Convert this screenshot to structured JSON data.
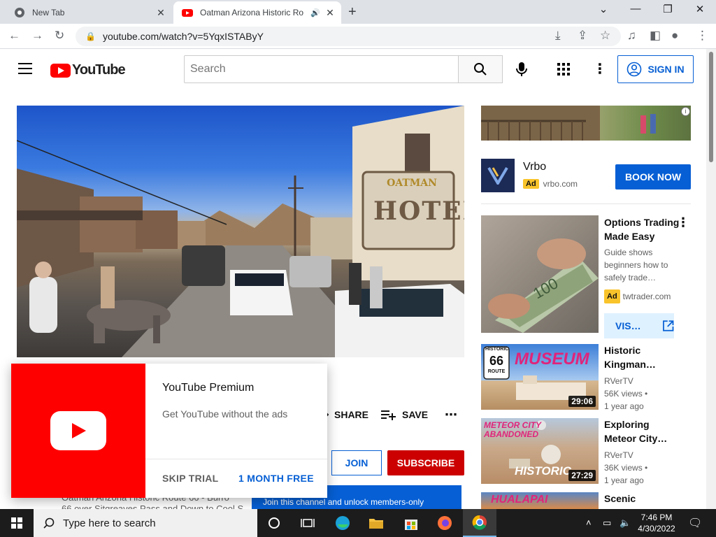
{
  "browser": {
    "tabs": [
      {
        "title": "New Tab",
        "active": false
      },
      {
        "title": "Oatman Arizona Historic Ro",
        "active": true
      }
    ],
    "url": "youtube.com/watch?v=5YqxISTAByY"
  },
  "masthead": {
    "logo_text": "YouTube",
    "search_placeholder": "Search",
    "signin_label": "SIGN IN"
  },
  "video": {
    "hotel_sign": "HOTEL",
    "hotel_sign_top": "OATMAN"
  },
  "actions": {
    "share_label": "SHARE",
    "save_label": "SAVE",
    "join_label": "JOIN",
    "subscribe_label": "SUBSCRIBE",
    "member_text": "Join this channel and unlock members-only",
    "description_partial": "Oatman Arizona Historic Route 66 - Burro",
    "description_partial2": "66 over Sitgreaves Pass and Down to Cool S"
  },
  "premium_popup": {
    "title": "YouTube Premium",
    "subtitle": "Get YouTube without the ads",
    "skip_label": "SKIP TRIAL",
    "free_label": "1 MONTH FREE"
  },
  "sidebar": {
    "ad": {
      "advertiser": "Vrbo",
      "badge": "Ad",
      "domain": "vrbo.com",
      "cta": "BOOK NOW"
    },
    "promo": {
      "title": "Options Trading Made Easy",
      "desc_lines": [
        "Guide shows",
        "beginners how to",
        "safely trade…"
      ],
      "badge": "Ad",
      "domain": "twtrader.com",
      "cta": "VIS…"
    },
    "videos": [
      {
        "title_lines": [
          "Historic",
          "Kingman…"
        ],
        "channel": "RVerTV",
        "views": "56K views",
        "age": "1 year ago",
        "duration": "29:06",
        "thumb_text": "MUSEUM",
        "thumb_badge_top": "HISTORIC",
        "thumb_badge_num": "66",
        "thumb_badge_bottom": "ROUTE"
      },
      {
        "title_lines": [
          "Exploring",
          "Meteor City…"
        ],
        "channel": "RVerTV",
        "views": "36K views",
        "age": "1 year ago",
        "duration": "27:29",
        "thumb_text": "METEOR CITY ABANDONED",
        "thumb_text2": "HISTORIC"
      },
      {
        "title_lines": [
          "Scenic"
        ],
        "thumb_text": "HUALAPAI"
      }
    ]
  },
  "taskbar": {
    "search_placeholder": "Type here to search",
    "time": "7:46 PM",
    "date": "4/30/2022"
  }
}
